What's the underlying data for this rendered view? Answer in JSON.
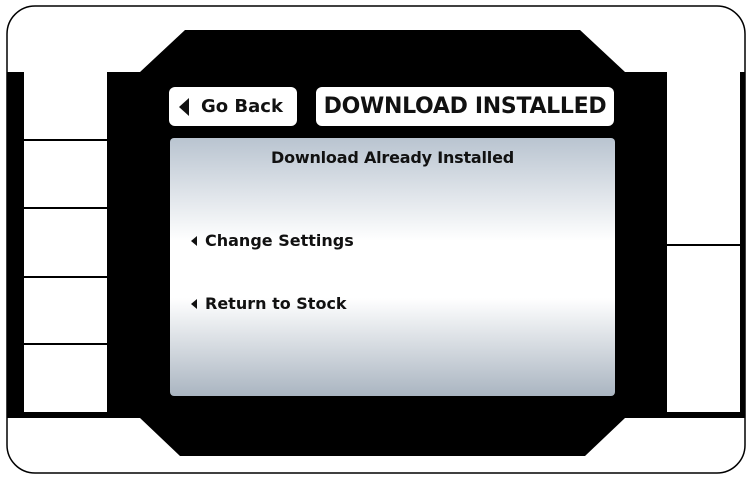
{
  "header": {
    "back_label": "Go Back",
    "title": "DOWNLOAD INSTALLED"
  },
  "screen": {
    "title": "Download Already Installed",
    "menu": [
      {
        "label": "Change Settings"
      },
      {
        "label": "Return to Stock"
      }
    ]
  },
  "icons": {
    "back": "triangle-left-icon",
    "menu_item": "triangle-left-icon"
  },
  "colors": {
    "bezel": "#000000",
    "screen_top": "#b9c4d0",
    "screen_mid": "#ffffff",
    "screen_bottom": "#aab5c1",
    "text": "#111111"
  }
}
